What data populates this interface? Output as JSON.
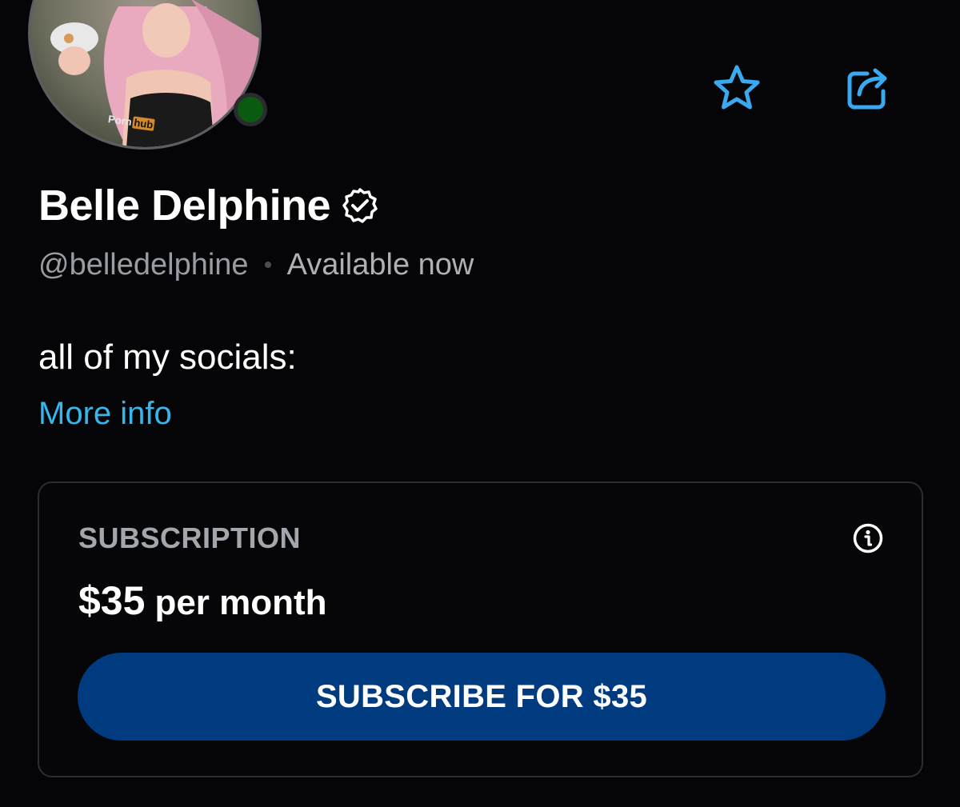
{
  "profile": {
    "display_name": "Belle Delphine",
    "handle": "@belledelphine",
    "status": "Available now",
    "verified": true,
    "online": true,
    "avatar_shirt_text_left": "Porn",
    "avatar_shirt_text_right": "hub"
  },
  "actions": {
    "favorite_icon": "star-icon",
    "share_icon": "share-icon"
  },
  "bio": {
    "text": "all of my socials:",
    "more_info_label": "More info"
  },
  "subscription": {
    "label": "SUBSCRIPTION",
    "price": "$35",
    "period": "per month",
    "button_label": "SUBSCRIBE FOR $35",
    "info_icon": "info-icon"
  },
  "colors": {
    "background": "#050507",
    "accent_link": "#34b7ec",
    "icon_blue": "#3aa9f0",
    "button_bg": "#003b80",
    "online_green": "#0a5a12",
    "muted_text": "#9a9ca3"
  }
}
